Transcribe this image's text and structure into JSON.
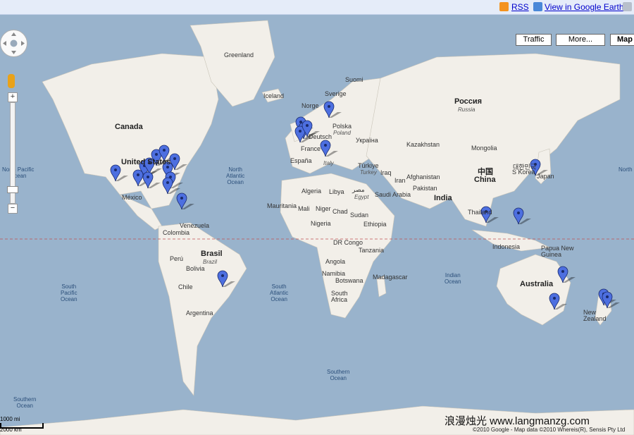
{
  "topbar": {
    "rss_label": "RSS",
    "earth_label": "View in Google Earth"
  },
  "map_type_buttons": {
    "traffic": "Traffic",
    "more": "More...",
    "map": "Map"
  },
  "zoom": {
    "in": "+",
    "out": "−"
  },
  "scale": {
    "miles": "1000 mi",
    "km": "2000 km"
  },
  "footer": {
    "watermark": "浪漫烛光 www.langmanzg.com",
    "copyright": "©2010 Google - Map data ©2010 Whereis(R), Sensis Pty Ltd"
  },
  "oceans": {
    "north_pacific": "North Pacific\nOcean",
    "north_atlantic": "North\nAtlantic\nOcean",
    "south_pacific": "South\nPacific\nOcean",
    "south_atlantic": "South\nAtlantic\nOcean",
    "indian": "Indian\nOcean",
    "southern_1": "Southern\nOcean",
    "southern_2": "Southern\nOcean",
    "north_pacific_right": "North"
  },
  "places": {
    "greenland": "Greenland",
    "iceland": "Iceland",
    "canada": "Canada",
    "united_states": "United States",
    "mexico": "México",
    "venezuela": "Venezuela",
    "colombia": "Colombia",
    "peru": "Perú",
    "bolivia": "Bolivia",
    "brasil": "Brasil",
    "brazil": "Brazil",
    "chile": "Chile",
    "argentina": "Argentina",
    "norway": "Norge",
    "sweden": "Sverige",
    "suomi": "Suomi",
    "polska": "Polska",
    "poland": "Poland",
    "deutsch": "Deutsch",
    "france": "France",
    "espana": "España",
    "italy": "Italy",
    "ukraine": "Україна",
    "turkiye": "Türkiye",
    "turkey": "Turkey",
    "algeria": "Algeria",
    "libya": "Libya",
    "egypt_local": "مصر",
    "egypt": "Egypt",
    "saudi": "Saudi Arabia",
    "iraq": "Iraq",
    "iran": "Iran",
    "afghanistan": "Afghanistan",
    "pakistan": "Pakistan",
    "india": "India",
    "mauritania": "Mauritania",
    "mali": "Mali",
    "niger": "Niger",
    "chad": "Chad",
    "sudan": "Sudan",
    "nigeria": "Nigeria",
    "ethiopia": "Ethiopia",
    "drcongo": "DR Congo",
    "tanzania": "Tanzania",
    "angola": "Angola",
    "namibia": "Namibia",
    "botswana": "Botswana",
    "madagascar": "Madagascar",
    "south_africa": "South Africa",
    "russia_local": "Россия",
    "russia": "Russia",
    "kazakhstan": "Kazakhstan",
    "mongolia": "Mongolia",
    "china_local": "中国",
    "china": "China",
    "s_korea": "S Korea",
    "korea_local": "대한민국",
    "japan": "Japan",
    "thailand": "Thailand",
    "indonesia": "Indonesia",
    "papua": "Papua New Guinea",
    "australia": "Australia",
    "new_zealand": "New Zealand"
  },
  "marker_color": "#4d6fe0"
}
